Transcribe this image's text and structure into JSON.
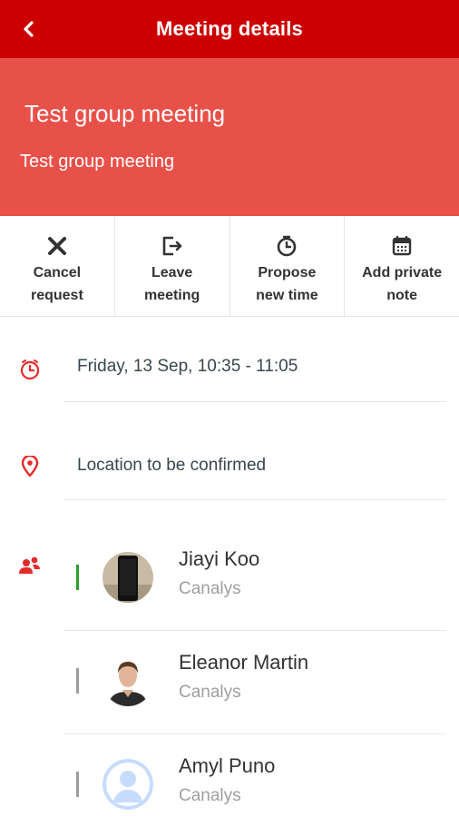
{
  "header": {
    "title": "Meeting details",
    "back_icon": "chevron-left-icon"
  },
  "meeting": {
    "title": "Test group meeting",
    "subtitle": "Test group meeting"
  },
  "actions": [
    {
      "label": "Cancel\nrequest",
      "icon": "close-icon"
    },
    {
      "label": "Leave\nmeeting",
      "icon": "exit-icon"
    },
    {
      "label": "Propose\nnew time",
      "icon": "clock-icon"
    },
    {
      "label": "Add private\nnote",
      "icon": "calendar-icon"
    }
  ],
  "details": {
    "datetime": "Friday, 13 Sep, 10:35 - 11:05",
    "location": "Location to be confirmed"
  },
  "attendees": [
    {
      "name": "Jiayi Koo",
      "org": "Canalys",
      "status_color": "#2e9e2e"
    },
    {
      "name": "Eleanor Martin",
      "org": "Canalys",
      "status_color": "#9e9e9e"
    },
    {
      "name": "Amyl Puno",
      "org": "Canalys",
      "status_color": "#9e9e9e"
    }
  ],
  "colors": {
    "appbar": "#cc0000",
    "hero": "#e8514a",
    "accent_icon": "#e52b2b"
  }
}
